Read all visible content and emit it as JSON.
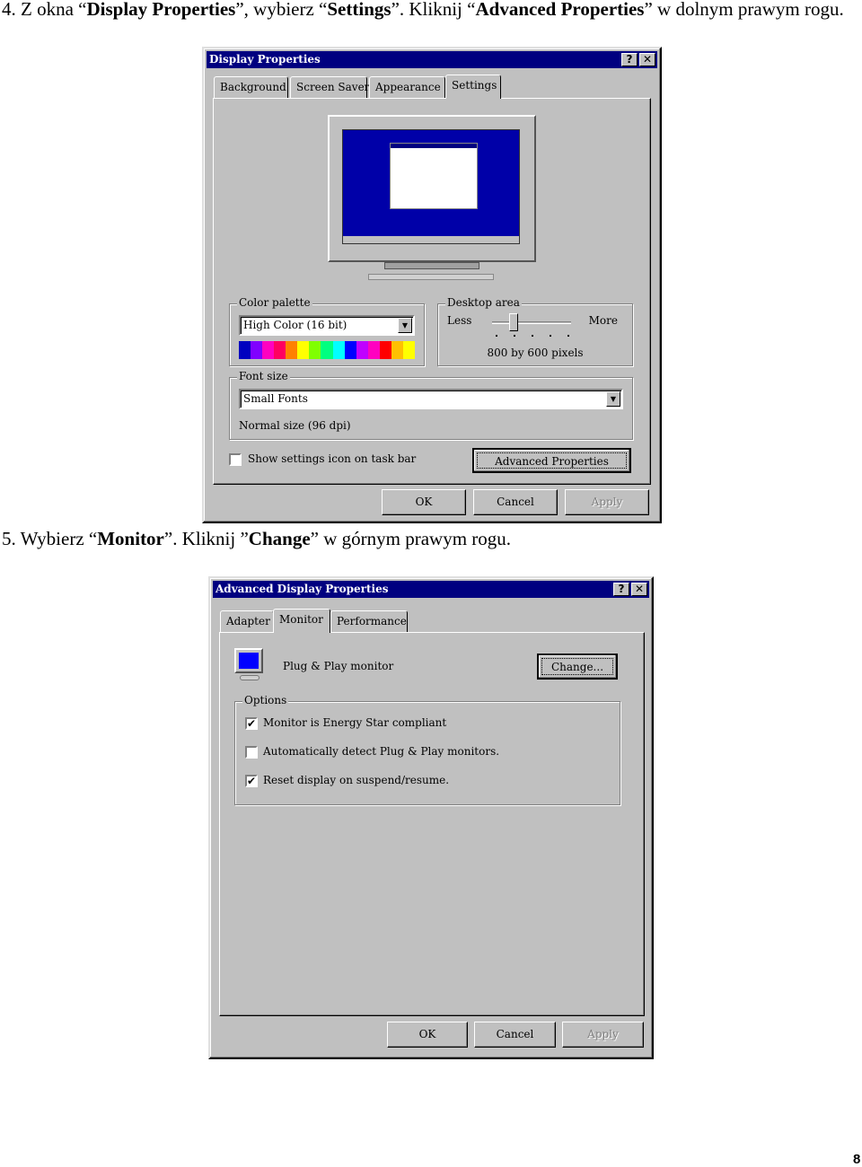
{
  "step4": {
    "number": "4.",
    "text_parts": [
      "Z okna “",
      "Display Properties",
      "”, wybierz “",
      "Settings",
      "”. Kliknij “",
      "Advanced Properties",
      "” w dolnym prawym rogu."
    ]
  },
  "dialog1": {
    "title": "Display Properties",
    "help_icon": "?",
    "close_icon": "✕",
    "tabs": [
      "Background",
      "Screen Saver",
      "Appearance",
      "Settings"
    ],
    "active_tab": "Settings",
    "color_palette": {
      "label": "Color palette",
      "value": "High Color (16 bit)",
      "spectrum": [
        "#0000c0",
        "#8000ff",
        "#ff00c0",
        "#ff0060",
        "#ff8000",
        "#ffff00",
        "#80ff00",
        "#00ff80",
        "#00ffff",
        "#0000ff",
        "#c000ff",
        "#ff00c0",
        "#ff0000",
        "#ffc000",
        "#ffff00"
      ]
    },
    "desktop_area": {
      "label": "Desktop area",
      "less": "Less",
      "more": "More",
      "value": "800 by 600 pixels",
      "slider_position": 1,
      "slider_stops": 5
    },
    "font_size": {
      "label": "Font size",
      "value": "Small Fonts",
      "note": "Normal size (96 dpi)"
    },
    "show_icon_checkbox": {
      "label": "Show settings icon on task bar",
      "checked": false
    },
    "advanced_button": "Advanced Properties",
    "buttons": {
      "ok": "OK",
      "cancel": "Cancel",
      "apply": "Apply"
    }
  },
  "step5": {
    "number": "5.",
    "text_parts": [
      "Wybierz “",
      "Monitor",
      "”. Kliknij ”",
      "Change",
      "” w górnym prawym rogu."
    ]
  },
  "dialog2": {
    "title": "Advanced Display Properties",
    "help_icon": "?",
    "close_icon": "✕",
    "tabs": [
      "Adapter",
      "Monitor",
      "Performance"
    ],
    "active_tab": "Monitor",
    "monitor_name": "Plug & Play monitor",
    "change_button": "Change...",
    "options": {
      "label": "Options",
      "items": [
        {
          "label": "Monitor is Energy Star compliant",
          "checked": true
        },
        {
          "label": "Automatically detect Plug & Play monitors.",
          "checked": false
        },
        {
          "label": "Reset display on suspend/resume.",
          "checked": true
        }
      ]
    },
    "buttons": {
      "ok": "OK",
      "cancel": "Cancel",
      "apply": "Apply"
    }
  },
  "page_number": "8"
}
